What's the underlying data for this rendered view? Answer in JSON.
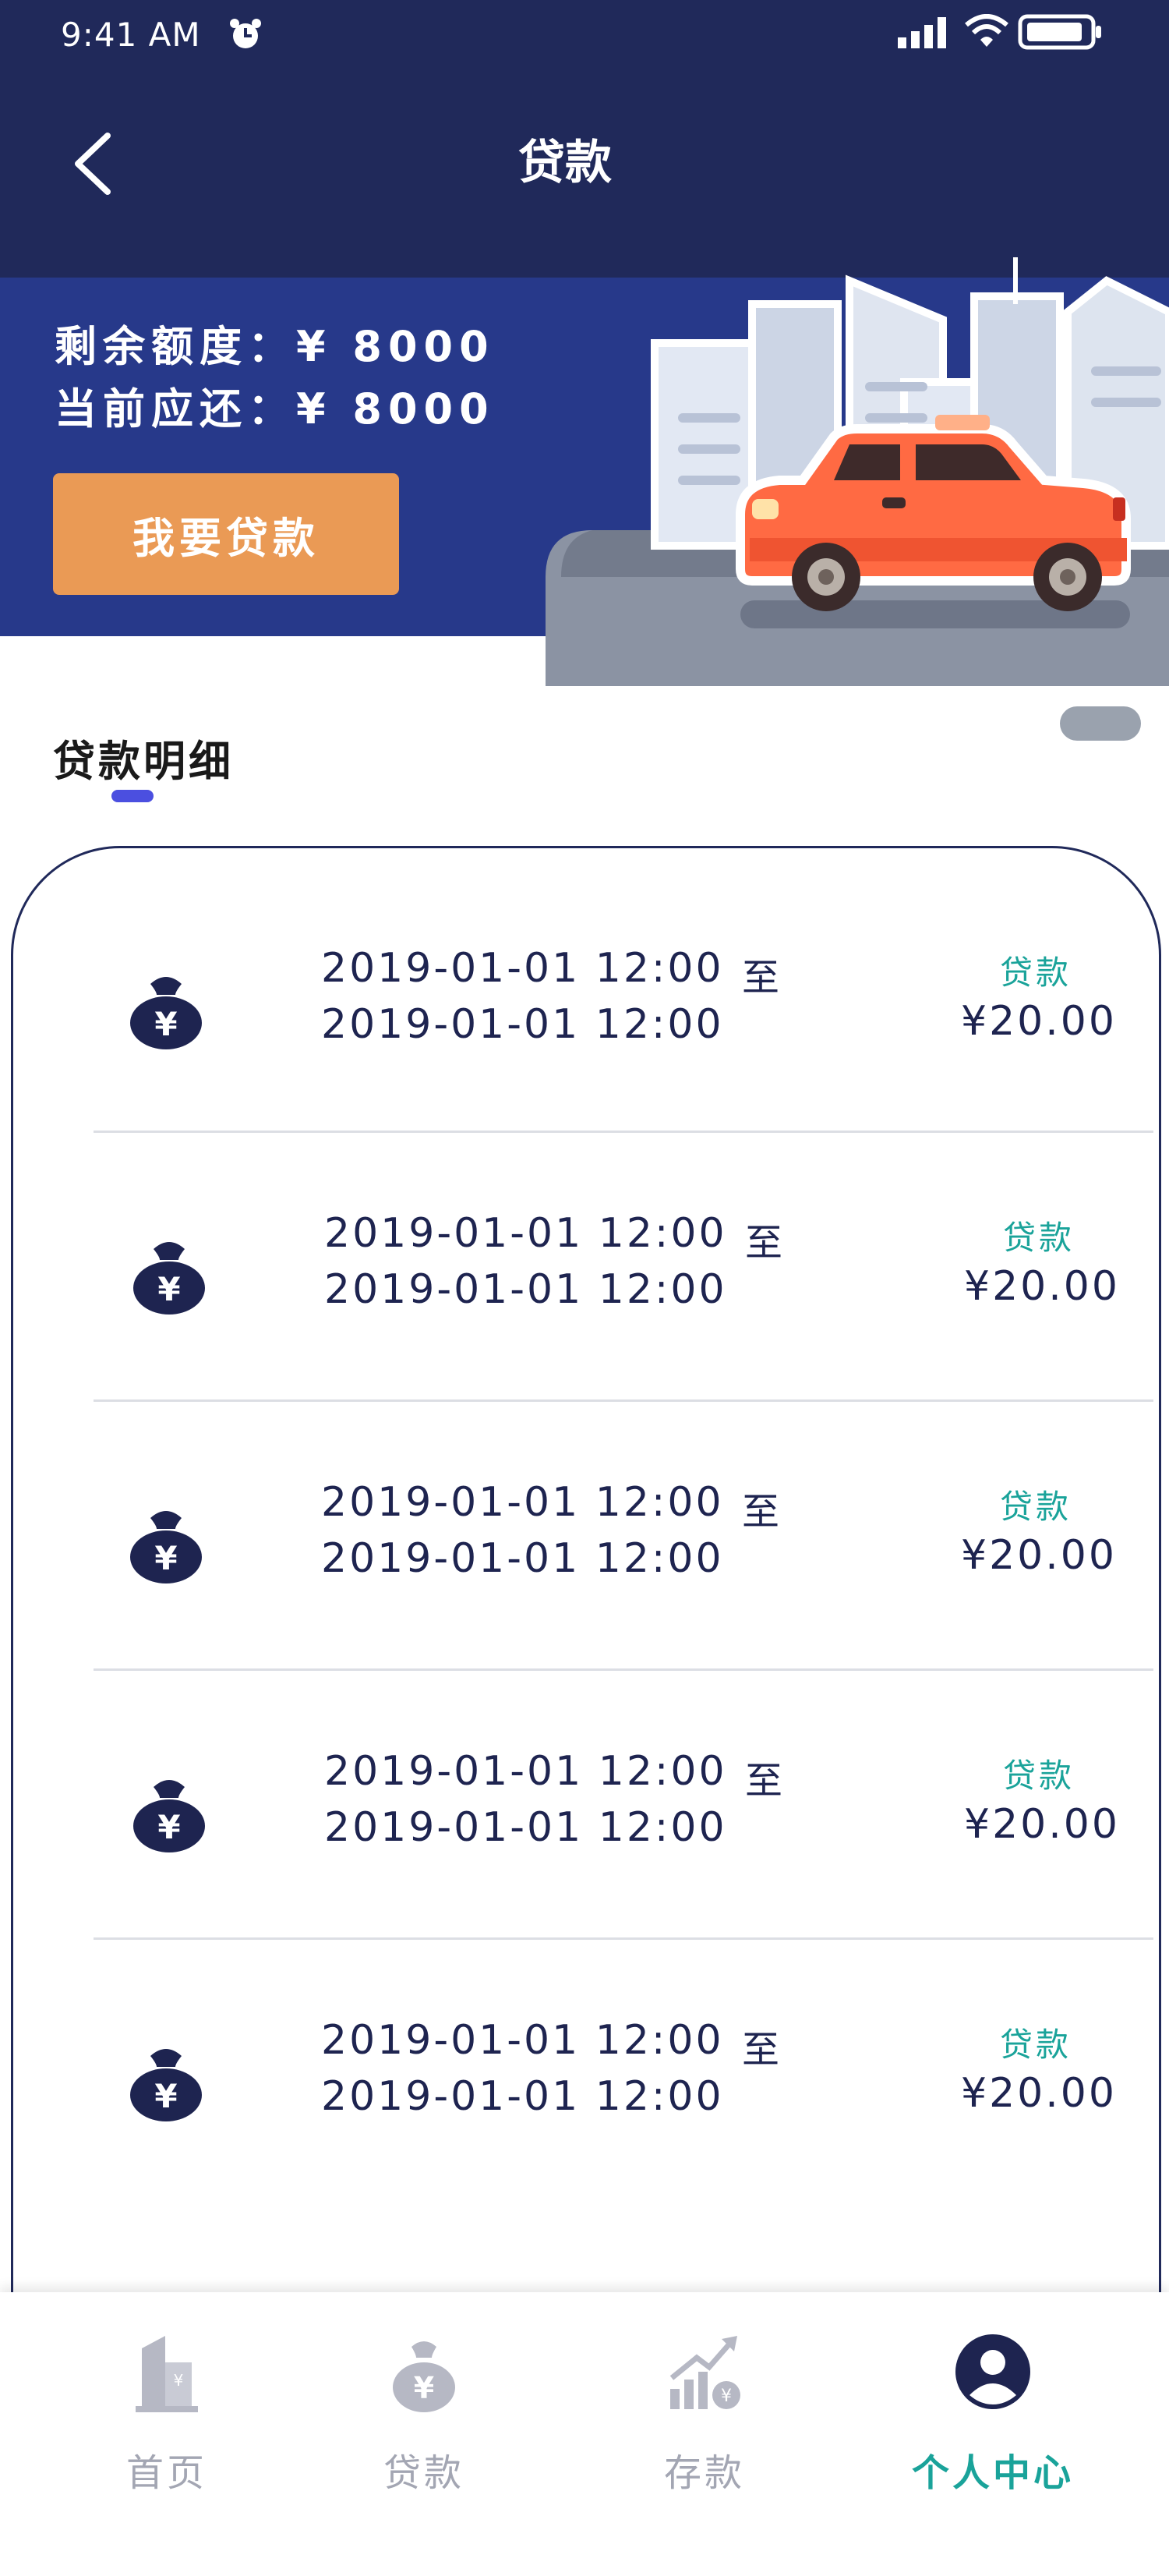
{
  "status_bar": {
    "time": "9:41 AM"
  },
  "header": {
    "title": "贷款"
  },
  "banner": {
    "remaining_quota": "剩余额度：¥ 8000",
    "current_due": "当前应还：¥ 8000",
    "loan_button": "我要贷款"
  },
  "section": {
    "title": "贷款明细"
  },
  "records": [
    {
      "start": "2019-01-01 12:00",
      "to": "至",
      "end": "2019-01-01 12:00",
      "type": "贷款",
      "amount": "¥20.00"
    },
    {
      "start": "2019-01-01 12:00",
      "to": "至",
      "end": "2019-01-01 12:00",
      "type": "贷款",
      "amount": "¥20.00"
    },
    {
      "start": "2019-01-01 12:00",
      "to": "至",
      "end": "2019-01-01 12:00",
      "type": "贷款",
      "amount": "¥20.00"
    },
    {
      "start": "2019-01-01 12:00",
      "to": "至",
      "end": "2019-01-01 12:00",
      "type": "贷款",
      "amount": "¥20.00"
    },
    {
      "start": "2019-01-01 12:00",
      "to": "至",
      "end": "2019-01-01 12:00",
      "type": "贷款",
      "amount": "¥20.00"
    }
  ],
  "tabs": [
    {
      "label": "首页",
      "icon": "building-icon",
      "active": false
    },
    {
      "label": "贷款",
      "icon": "money-bag-icon",
      "active": false
    },
    {
      "label": "存款",
      "icon": "growth-chart-icon",
      "active": false
    },
    {
      "label": "个人中心",
      "icon": "user-icon",
      "active": true
    }
  ],
  "colors": {
    "header_bg": "#20295a",
    "banner_bg": "#27398a",
    "button_bg": "#ea9a55",
    "accent_teal": "#1aa39a",
    "tab_inactive": "#a3a6b3"
  }
}
